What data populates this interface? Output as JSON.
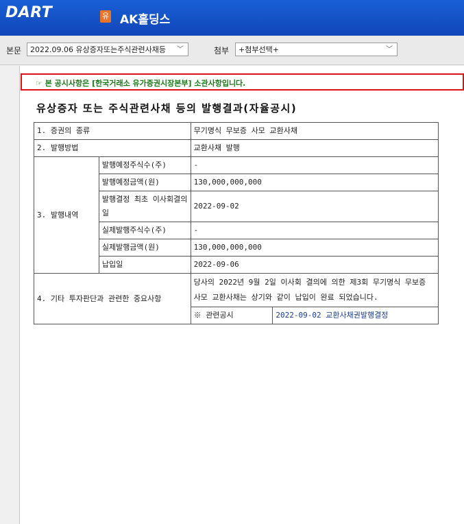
{
  "app": {
    "logo": "DART",
    "company_badge": "유",
    "company_name": "AK홀딩스"
  },
  "toolbar": {
    "main_label": "본문",
    "main_select": "2022.09.06  유상증자또는주식관련사채등",
    "attach_label": "첨부",
    "attach_select": "+첨부선택+"
  },
  "notice": "☞ 본 공시사항은 [한국거래소 유가증권시장본부] 소관사항입니다.",
  "title": "유상증자 또는 주식관련사채 등의 발행결과(자율공시)",
  "table": {
    "r1_label": "1. 증권의 종류",
    "r1_value": "무기명식 무보증 사모 교환사채",
    "r2_label": "2. 발행방법",
    "r2_value": "교환사채 발행",
    "r3_label": "3. 발행내역",
    "r3_rows": [
      {
        "label": "발행예정주식수(주)",
        "value": "-"
      },
      {
        "label": "발행예정금액(원)",
        "value": "130,000,000,000"
      },
      {
        "label": "발행결정 최초 이사회결의일",
        "value": "2022-09-02"
      },
      {
        "label": "실제발행주식수(주)",
        "value": "-"
      },
      {
        "label": "실제발행금액(원)",
        "value": "130,000,000,000"
      },
      {
        "label": "납입일",
        "value": "2022-09-06"
      }
    ],
    "r4_label": "4. 기타 투자판단과 관련한 중요사항",
    "r4_value": "당사의 2022년 9월 2일 이사회 결의에 의한 제3회 무기명식 무보증 사모 교환사채는 상기와 같이 납입이 완료 되었습니다.",
    "related_label": "※ 관련공시",
    "related_link": "2022-09-02 교환사채권발행결정"
  },
  "colors": {
    "header_blue": "#1a5fd6",
    "notice_border": "#dd1111",
    "notice_text": "#1a7a1a",
    "link": "#1a3c8a"
  }
}
